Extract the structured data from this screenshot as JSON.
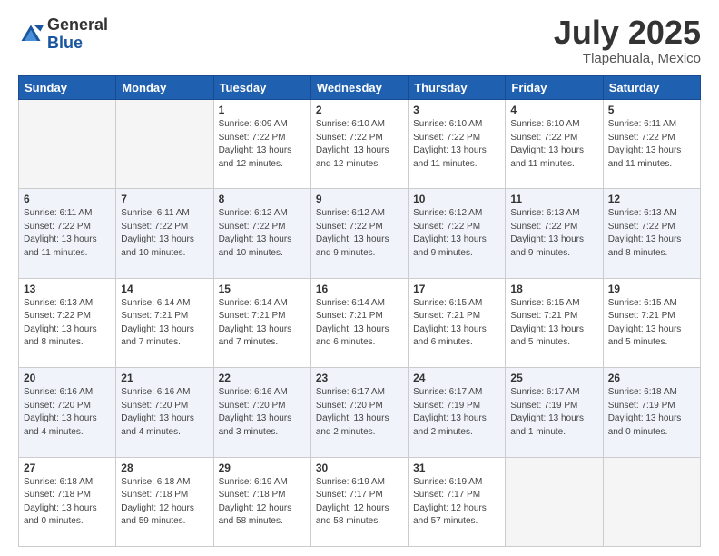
{
  "header": {
    "logo_general": "General",
    "logo_blue": "Blue",
    "title": "July 2025",
    "location": "Tlapehuala, Mexico"
  },
  "days_of_week": [
    "Sunday",
    "Monday",
    "Tuesday",
    "Wednesday",
    "Thursday",
    "Friday",
    "Saturday"
  ],
  "weeks": [
    {
      "alt": false,
      "days": [
        {
          "num": "",
          "info": "",
          "empty": true
        },
        {
          "num": "",
          "info": "",
          "empty": true
        },
        {
          "num": "1",
          "info": "Sunrise: 6:09 AM\nSunset: 7:22 PM\nDaylight: 13 hours\nand 12 minutes.",
          "empty": false
        },
        {
          "num": "2",
          "info": "Sunrise: 6:10 AM\nSunset: 7:22 PM\nDaylight: 13 hours\nand 12 minutes.",
          "empty": false
        },
        {
          "num": "3",
          "info": "Sunrise: 6:10 AM\nSunset: 7:22 PM\nDaylight: 13 hours\nand 11 minutes.",
          "empty": false
        },
        {
          "num": "4",
          "info": "Sunrise: 6:10 AM\nSunset: 7:22 PM\nDaylight: 13 hours\nand 11 minutes.",
          "empty": false
        },
        {
          "num": "5",
          "info": "Sunrise: 6:11 AM\nSunset: 7:22 PM\nDaylight: 13 hours\nand 11 minutes.",
          "empty": false
        }
      ]
    },
    {
      "alt": true,
      "days": [
        {
          "num": "6",
          "info": "Sunrise: 6:11 AM\nSunset: 7:22 PM\nDaylight: 13 hours\nand 11 minutes.",
          "empty": false
        },
        {
          "num": "7",
          "info": "Sunrise: 6:11 AM\nSunset: 7:22 PM\nDaylight: 13 hours\nand 10 minutes.",
          "empty": false
        },
        {
          "num": "8",
          "info": "Sunrise: 6:12 AM\nSunset: 7:22 PM\nDaylight: 13 hours\nand 10 minutes.",
          "empty": false
        },
        {
          "num": "9",
          "info": "Sunrise: 6:12 AM\nSunset: 7:22 PM\nDaylight: 13 hours\nand 9 minutes.",
          "empty": false
        },
        {
          "num": "10",
          "info": "Sunrise: 6:12 AM\nSunset: 7:22 PM\nDaylight: 13 hours\nand 9 minutes.",
          "empty": false
        },
        {
          "num": "11",
          "info": "Sunrise: 6:13 AM\nSunset: 7:22 PM\nDaylight: 13 hours\nand 9 minutes.",
          "empty": false
        },
        {
          "num": "12",
          "info": "Sunrise: 6:13 AM\nSunset: 7:22 PM\nDaylight: 13 hours\nand 8 minutes.",
          "empty": false
        }
      ]
    },
    {
      "alt": false,
      "days": [
        {
          "num": "13",
          "info": "Sunrise: 6:13 AM\nSunset: 7:22 PM\nDaylight: 13 hours\nand 8 minutes.",
          "empty": false
        },
        {
          "num": "14",
          "info": "Sunrise: 6:14 AM\nSunset: 7:21 PM\nDaylight: 13 hours\nand 7 minutes.",
          "empty": false
        },
        {
          "num": "15",
          "info": "Sunrise: 6:14 AM\nSunset: 7:21 PM\nDaylight: 13 hours\nand 7 minutes.",
          "empty": false
        },
        {
          "num": "16",
          "info": "Sunrise: 6:14 AM\nSunset: 7:21 PM\nDaylight: 13 hours\nand 6 minutes.",
          "empty": false
        },
        {
          "num": "17",
          "info": "Sunrise: 6:15 AM\nSunset: 7:21 PM\nDaylight: 13 hours\nand 6 minutes.",
          "empty": false
        },
        {
          "num": "18",
          "info": "Sunrise: 6:15 AM\nSunset: 7:21 PM\nDaylight: 13 hours\nand 5 minutes.",
          "empty": false
        },
        {
          "num": "19",
          "info": "Sunrise: 6:15 AM\nSunset: 7:21 PM\nDaylight: 13 hours\nand 5 minutes.",
          "empty": false
        }
      ]
    },
    {
      "alt": true,
      "days": [
        {
          "num": "20",
          "info": "Sunrise: 6:16 AM\nSunset: 7:20 PM\nDaylight: 13 hours\nand 4 minutes.",
          "empty": false
        },
        {
          "num": "21",
          "info": "Sunrise: 6:16 AM\nSunset: 7:20 PM\nDaylight: 13 hours\nand 4 minutes.",
          "empty": false
        },
        {
          "num": "22",
          "info": "Sunrise: 6:16 AM\nSunset: 7:20 PM\nDaylight: 13 hours\nand 3 minutes.",
          "empty": false
        },
        {
          "num": "23",
          "info": "Sunrise: 6:17 AM\nSunset: 7:20 PM\nDaylight: 13 hours\nand 2 minutes.",
          "empty": false
        },
        {
          "num": "24",
          "info": "Sunrise: 6:17 AM\nSunset: 7:19 PM\nDaylight: 13 hours\nand 2 minutes.",
          "empty": false
        },
        {
          "num": "25",
          "info": "Sunrise: 6:17 AM\nSunset: 7:19 PM\nDaylight: 13 hours\nand 1 minute.",
          "empty": false
        },
        {
          "num": "26",
          "info": "Sunrise: 6:18 AM\nSunset: 7:19 PM\nDaylight: 13 hours\nand 0 minutes.",
          "empty": false
        }
      ]
    },
    {
      "alt": false,
      "days": [
        {
          "num": "27",
          "info": "Sunrise: 6:18 AM\nSunset: 7:18 PM\nDaylight: 13 hours\nand 0 minutes.",
          "empty": false
        },
        {
          "num": "28",
          "info": "Sunrise: 6:18 AM\nSunset: 7:18 PM\nDaylight: 12 hours\nand 59 minutes.",
          "empty": false
        },
        {
          "num": "29",
          "info": "Sunrise: 6:19 AM\nSunset: 7:18 PM\nDaylight: 12 hours\nand 58 minutes.",
          "empty": false
        },
        {
          "num": "30",
          "info": "Sunrise: 6:19 AM\nSunset: 7:17 PM\nDaylight: 12 hours\nand 58 minutes.",
          "empty": false
        },
        {
          "num": "31",
          "info": "Sunrise: 6:19 AM\nSunset: 7:17 PM\nDaylight: 12 hours\nand 57 minutes.",
          "empty": false
        },
        {
          "num": "",
          "info": "",
          "empty": true
        },
        {
          "num": "",
          "info": "",
          "empty": true
        }
      ]
    }
  ]
}
